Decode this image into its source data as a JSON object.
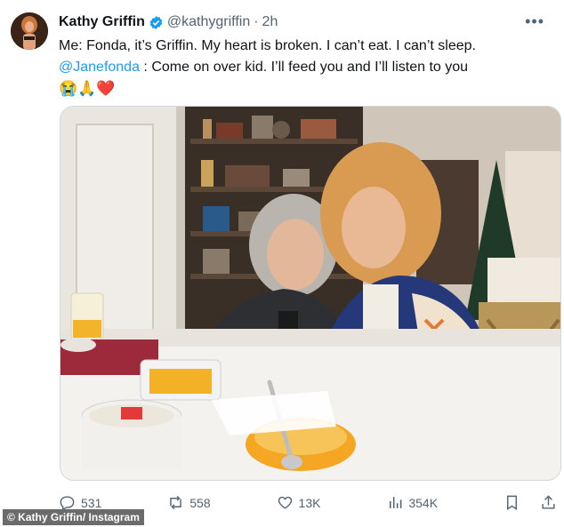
{
  "post": {
    "author_name": "Kathy Griffin",
    "author_handle": "@kathygriffin",
    "separator": "·",
    "time": "2h",
    "text_line1": "Me: Fonda, it’s Griffin. My heart is broken. I can’t eat. I can’t sleep.",
    "mention": "@Janefonda",
    "text_line2_rest": " : Come on over kid. I’ll feed you and I’ll listen to you",
    "emojis": "😭🙏❤️"
  },
  "metrics": {
    "replies": "531",
    "reposts": "558",
    "likes": "13K",
    "views": "354K"
  },
  "icons": {
    "verified": "verified-badge-icon",
    "more": "more-options-icon",
    "reply": "reply-icon",
    "repost": "repost-icon",
    "like": "like-icon",
    "views": "views-icon",
    "bookmark": "bookmark-icon",
    "share": "share-icon"
  },
  "colors": {
    "verified": "#1d9bf0",
    "mention": "#1d9bf0",
    "secondary_text": "#536471"
  },
  "credit": "© Kathy Griffin/ Instagram"
}
